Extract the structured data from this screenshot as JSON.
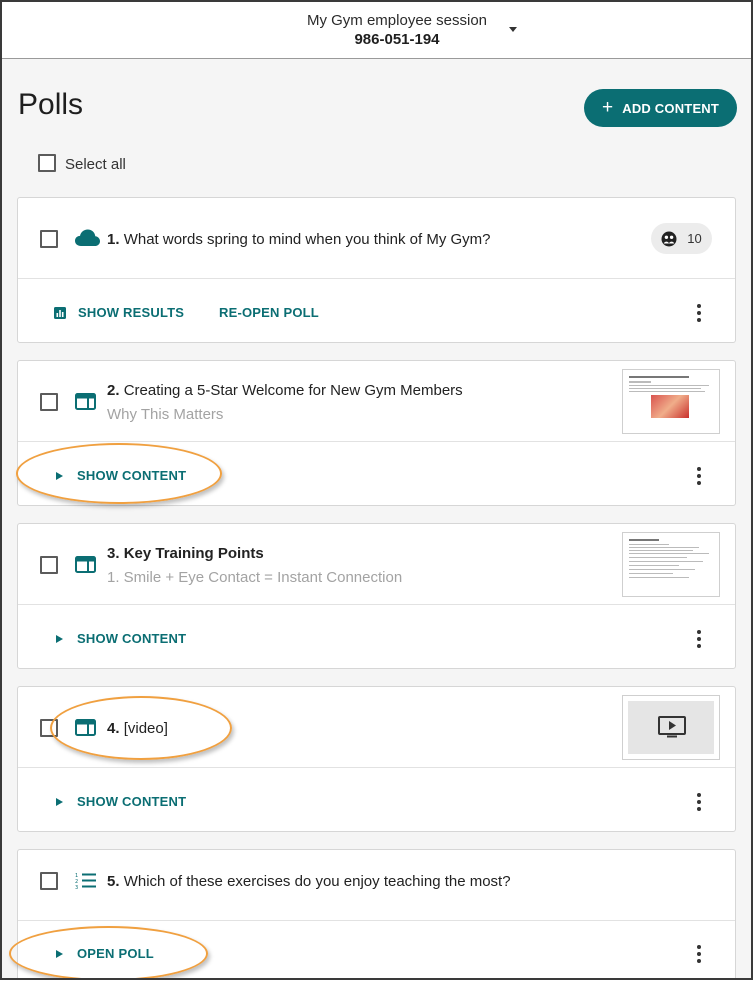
{
  "session": {
    "name": "My Gym employee session",
    "code": "986-051-194"
  },
  "page": {
    "title": "Polls",
    "add_content_label": "ADD CONTENT",
    "select_all_label": "Select all"
  },
  "items": [
    {
      "number": "1.",
      "title": "What words spring to mind when you think of My Gym?",
      "response_count": "10",
      "actions": [
        "SHOW RESULTS",
        "RE-OPEN POLL"
      ],
      "icon": "word-cloud-icon"
    },
    {
      "number": "2.",
      "title": "Creating a 5-Star Welcome for New Gym Members",
      "subtitle": "Why This Matters",
      "action": "SHOW CONTENT",
      "icon": "slide-content-icon"
    },
    {
      "number": "3.",
      "title": "Key Training Points",
      "subtitle": "1. Smile + Eye Contact = Instant Connection",
      "action": "SHOW CONTENT",
      "icon": "slide-content-icon"
    },
    {
      "number": "4.",
      "title": "[video]",
      "action": "SHOW CONTENT",
      "icon": "slide-content-icon"
    },
    {
      "number": "5.",
      "title": "Which of these exercises do you enjoy teaching the most?",
      "action": "OPEN POLL",
      "icon": "ranking-list-icon"
    }
  ],
  "colors": {
    "accent": "#0b6e73",
    "highlight_ring": "#f0a040"
  }
}
